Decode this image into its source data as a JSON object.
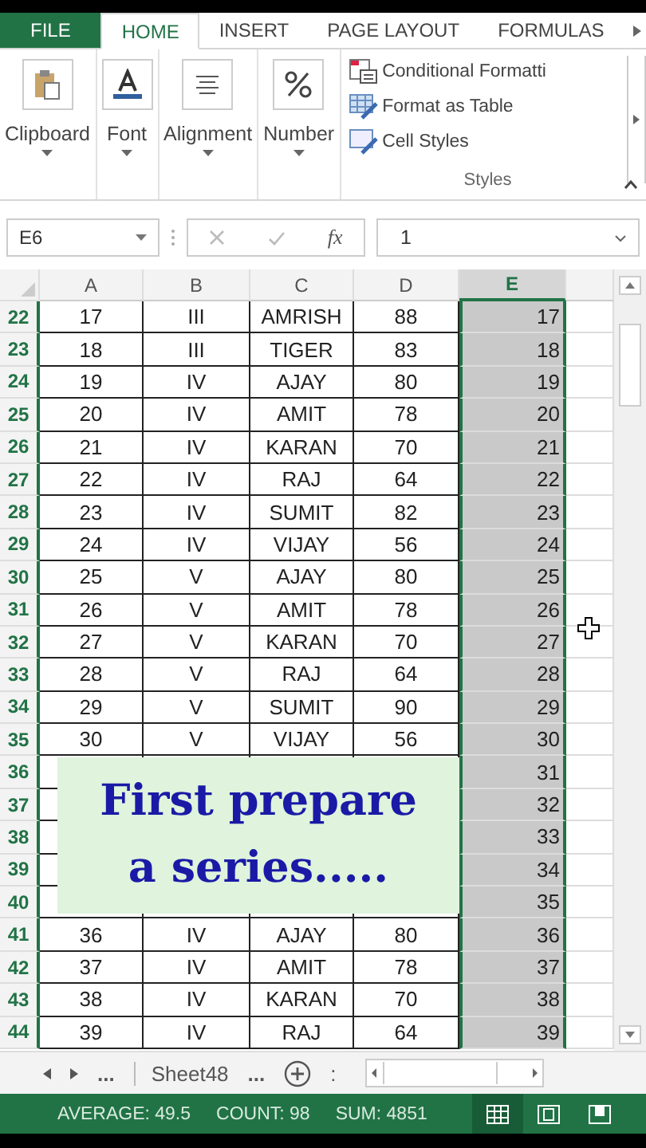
{
  "tabs": [
    {
      "label": "FILE",
      "kind": "file",
      "selected": false
    },
    {
      "label": "HOME",
      "kind": "tab",
      "selected": true
    },
    {
      "label": "INSERT",
      "kind": "tab",
      "selected": false
    },
    {
      "label": "PAGE LAYOUT",
      "kind": "tab",
      "selected": false
    },
    {
      "label": "FORMULAS",
      "kind": "tab",
      "selected": false
    }
  ],
  "ribbon": {
    "groups": [
      {
        "label": "Clipboard",
        "kind": "clipboard"
      },
      {
        "label": "Font",
        "kind": "font"
      },
      {
        "label": "Alignment",
        "kind": "align"
      },
      {
        "label": "Number",
        "kind": "percent"
      }
    ],
    "styles": {
      "items": [
        {
          "label": "Conditional Formatti",
          "kind": "conditional"
        },
        {
          "label": "Format as Table",
          "kind": "table"
        },
        {
          "label": "Cell Styles",
          "kind": "cellstyle"
        }
      ],
      "label": "Styles"
    }
  },
  "formula_bar": {
    "name_box": "E6",
    "function_label": "fx",
    "value": "1"
  },
  "columns": [
    {
      "label": "A",
      "selected": false
    },
    {
      "label": "B",
      "selected": false
    },
    {
      "label": "C",
      "selected": false
    },
    {
      "label": "D",
      "selected": false
    },
    {
      "label": "E",
      "selected": true
    }
  ],
  "rows": [
    {
      "num": "22",
      "a": "17",
      "b": "III",
      "c": "AMRISH",
      "d": "88",
      "e": "17"
    },
    {
      "num": "23",
      "a": "18",
      "b": "III",
      "c": "TIGER",
      "d": "83",
      "e": "18"
    },
    {
      "num": "24",
      "a": "19",
      "b": "IV",
      "c": "AJAY",
      "d": "80",
      "e": "19"
    },
    {
      "num": "25",
      "a": "20",
      "b": "IV",
      "c": "AMIT",
      "d": "78",
      "e": "20"
    },
    {
      "num": "26",
      "a": "21",
      "b": "IV",
      "c": "KARAN",
      "d": "70",
      "e": "21"
    },
    {
      "num": "27",
      "a": "22",
      "b": "IV",
      "c": "RAJ",
      "d": "64",
      "e": "22"
    },
    {
      "num": "28",
      "a": "23",
      "b": "IV",
      "c": "SUMIT",
      "d": "82",
      "e": "23"
    },
    {
      "num": "29",
      "a": "24",
      "b": "IV",
      "c": "VIJAY",
      "d": "56",
      "e": "24"
    },
    {
      "num": "30",
      "a": "25",
      "b": "V",
      "c": "AJAY",
      "d": "80",
      "e": "25"
    },
    {
      "num": "31",
      "a": "26",
      "b": "V",
      "c": "AMIT",
      "d": "78",
      "e": "26"
    },
    {
      "num": "32",
      "a": "27",
      "b": "V",
      "c": "KARAN",
      "d": "70",
      "e": "27"
    },
    {
      "num": "33",
      "a": "28",
      "b": "V",
      "c": "RAJ",
      "d": "64",
      "e": "28"
    },
    {
      "num": "34",
      "a": "29",
      "b": "V",
      "c": "SUMIT",
      "d": "90",
      "e": "29"
    },
    {
      "num": "35",
      "a": "30",
      "b": "V",
      "c": "VIJAY",
      "d": "56",
      "e": "30"
    },
    {
      "num": "36",
      "e": "31"
    },
    {
      "num": "37",
      "e": "32"
    },
    {
      "num": "38",
      "e": "33"
    },
    {
      "num": "39",
      "e": "34"
    },
    {
      "num": "40",
      "e": "35"
    },
    {
      "num": "41",
      "a": "36",
      "b": "IV",
      "c": "AJAY",
      "d": "80",
      "e": "36"
    },
    {
      "num": "42",
      "a": "37",
      "b": "IV",
      "c": "AMIT",
      "d": "78",
      "e": "37"
    },
    {
      "num": "43",
      "a": "38",
      "b": "IV",
      "c": "KARAN",
      "d": "70",
      "e": "38"
    },
    {
      "num": "44",
      "a": "39",
      "b": "IV",
      "c": "RAJ",
      "d": "64",
      "e": "39"
    }
  ],
  "caption": [
    "First prepare",
    "a series....."
  ],
  "sheet_bar": {
    "more_left": "...",
    "sheet": "Sheet48",
    "more_right": "...",
    "divider": ":"
  },
  "status_bar": {
    "items": [
      "AVERAGE: 49.5",
      "COUNT: 98",
      "SUM: 4851"
    ],
    "views": [
      {
        "kind": "normal",
        "selected": true
      },
      {
        "kind": "page",
        "selected": false
      },
      {
        "kind": "break",
        "selected": false
      }
    ]
  }
}
